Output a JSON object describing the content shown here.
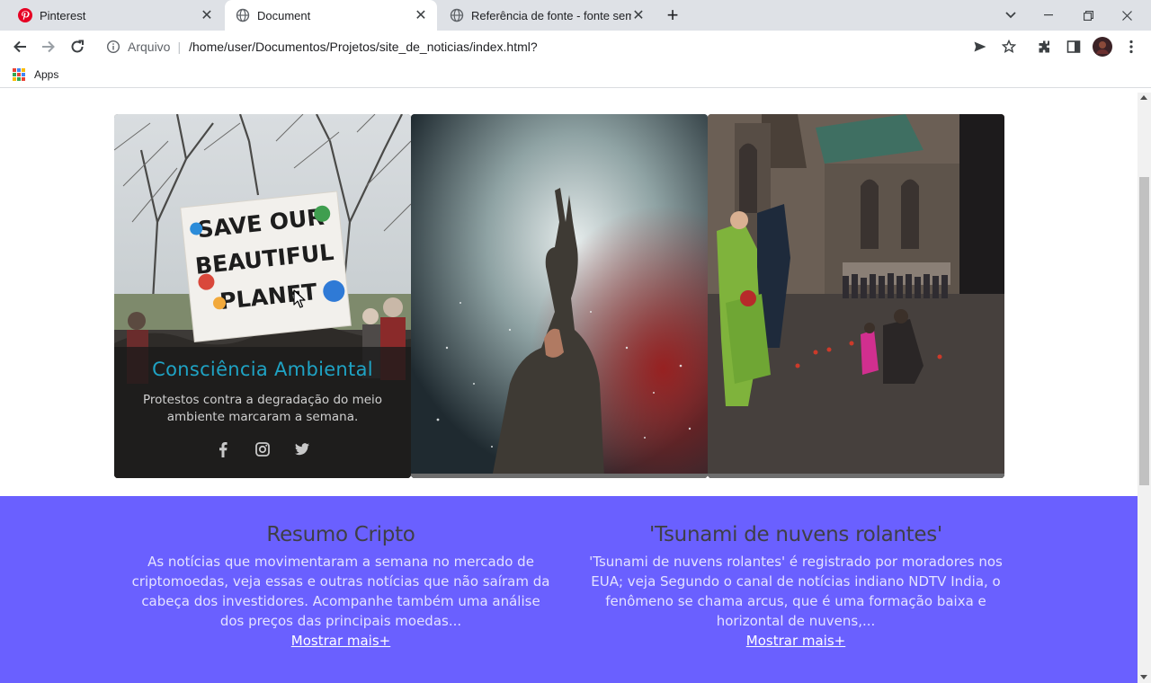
{
  "browser": {
    "tabs": [
      {
        "title": "Pinterest",
        "icon": "pinterest-icon",
        "active": false
      },
      {
        "title": "Document",
        "icon": "globe-icon",
        "active": true
      },
      {
        "title": "Referência de fonte - fonte sem r",
        "icon": "globe-icon",
        "active": false
      }
    ],
    "address": {
      "scheme_label": "Arquivo",
      "url": "/home/user/Documentos/Projetos/site_de_noticias/index.html?"
    },
    "bookmarks": {
      "apps_label": "Apps"
    }
  },
  "page": {
    "cards": [
      {
        "title": "Consciência Ambiental",
        "description": "Protestos contra a degradação do meio ambiente marcaram a semana.",
        "banner_lines": [
          "SAVE OUR",
          "BEAUTIFUL",
          "PLANET"
        ],
        "social": [
          "facebook-icon",
          "instagram-icon",
          "twitter-icon"
        ]
      },
      {
        "title": "",
        "description": ""
      },
      {
        "title": "",
        "description": ""
      }
    ],
    "news": [
      {
        "title": "Resumo Cripto",
        "text": "As notícias que movimentaram a semana no mercado de criptomoedas, veja essas e outras notícias que não saíram da cabeça dos investidores. Acompanhe também uma análise dos preços das principais moedas...",
        "more": "Mostrar mais+"
      },
      {
        "title": "'Tsunami de nuvens rolantes'",
        "text": "'Tsunami de nuvens rolantes' é registrado por moradores nos EUA; veja Segundo o canal de notícias indiano NDTV India, o fenômeno se chama arcus, que é uma formação baixa e horizontal de nuvens,...",
        "more": "Mostrar mais+"
      }
    ],
    "colors": {
      "news_background": "#6a60ff",
      "card_title": "#1fa3c4"
    }
  }
}
